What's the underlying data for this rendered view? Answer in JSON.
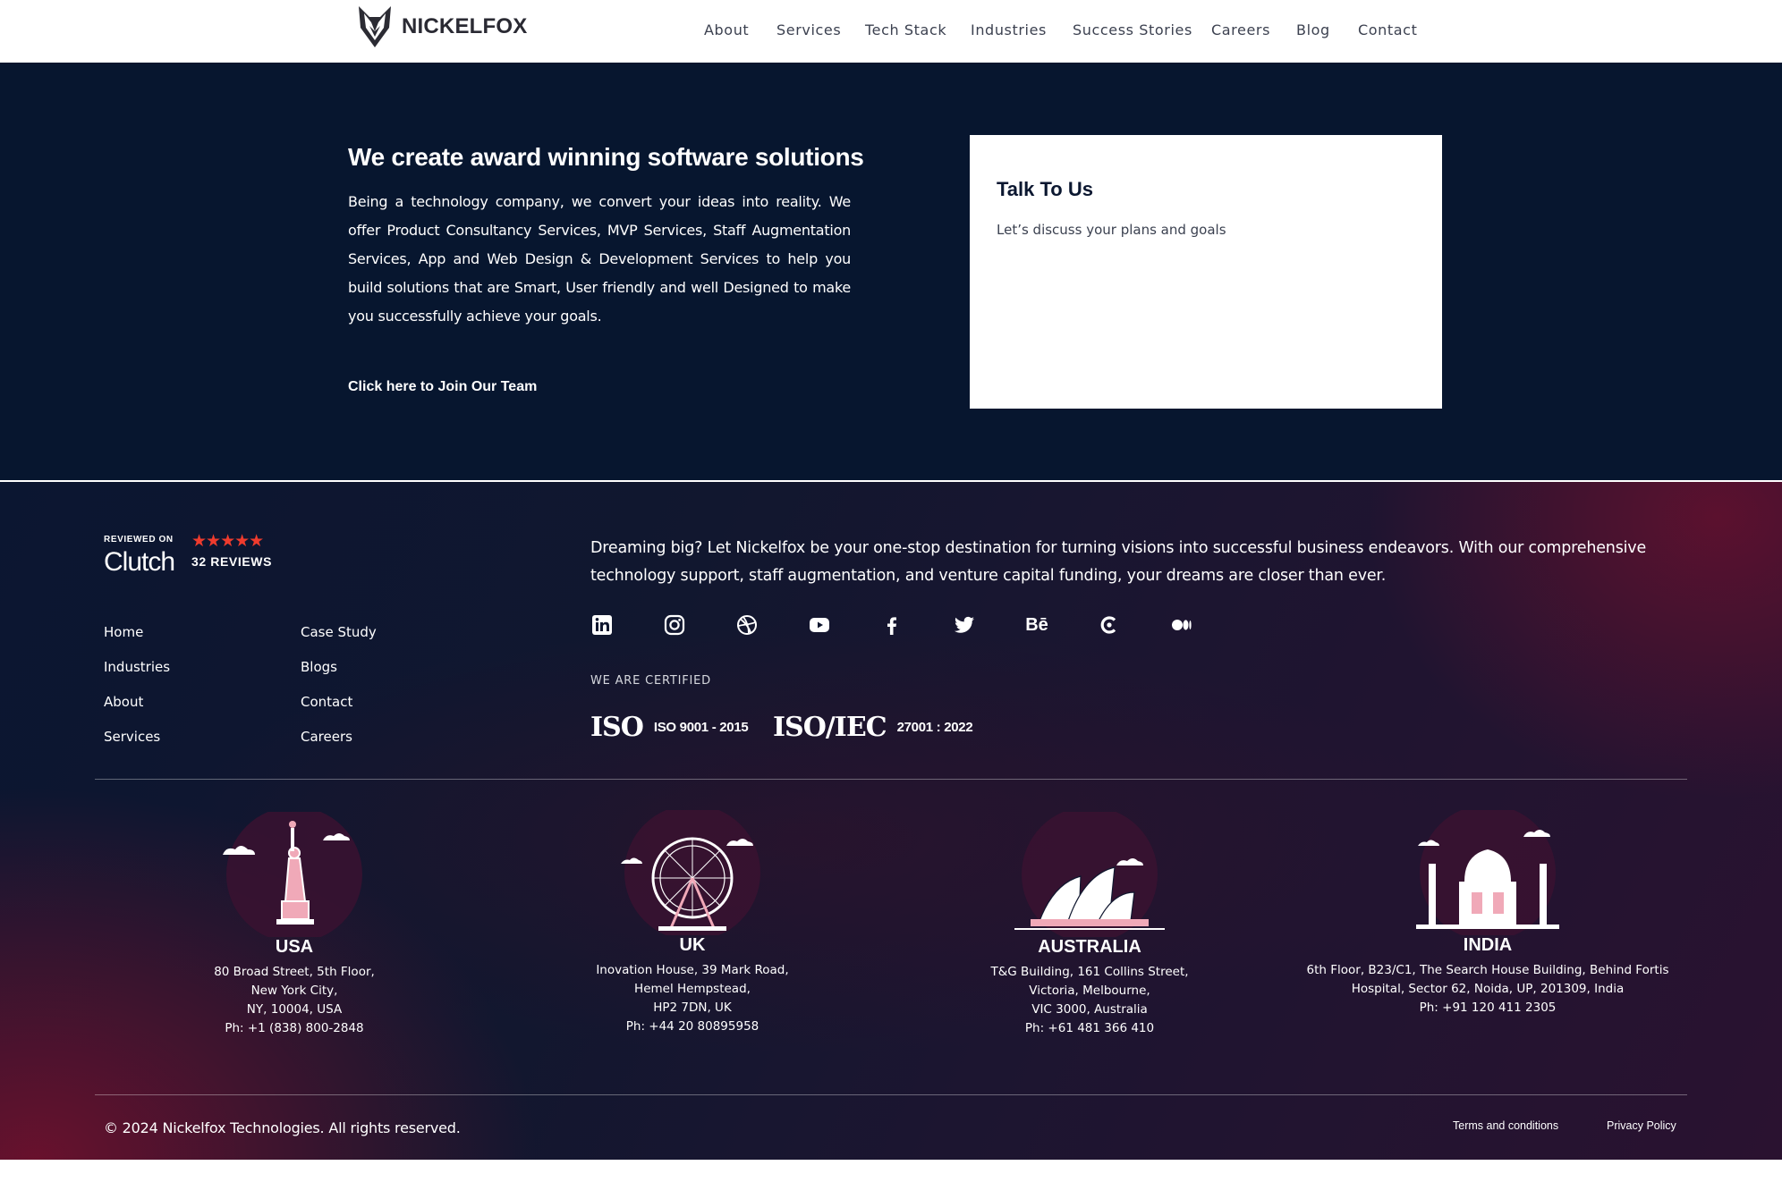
{
  "brand": {
    "name": "NICKELFOX"
  },
  "nav": {
    "items": [
      "About",
      "Services",
      "Tech Stack",
      "Industries",
      "Success Stories",
      "Careers",
      "Blog",
      "Contact"
    ]
  },
  "hero": {
    "title": "We create award winning software solutions",
    "body": "Being a technology company, we convert your ideas into reality. We offer Product Consultancy Services, MVP Services, Staff Augmentation Services, App and Web Design & Development Services to help you build solutions that are Smart, User friendly and well Designed to make you successfully achieve your goals.",
    "join_link": "Click here to Join Our Team"
  },
  "talk": {
    "title": "Talk To Us",
    "subtitle": "Let’s discuss your plans and goals"
  },
  "clutch": {
    "reviewed_on": "REVIEWED ON",
    "name": "Clutch",
    "stars": "★★★★★",
    "count": "32 REVIEWS",
    "rating_stars": 5
  },
  "footer_links": [
    "Home",
    "Case Study",
    "Industries",
    "Blogs",
    "About",
    "Contact",
    "Services",
    "Careers"
  ],
  "tagline": "Dreaming big? Let Nickelfox be your one-stop destination for turning visions into successful business endeavors. With our comprehensive technology support, staff augmentation, and venture capital funding, your dreams are closer than ever.",
  "socials": [
    "linkedin-icon",
    "instagram-icon",
    "dribbble-icon",
    "youtube-icon",
    "facebook-icon",
    "twitter-icon",
    "behance-icon",
    "clutch-icon",
    "medium-icon"
  ],
  "behance_glyph": "Bē",
  "certifications": {
    "label": "WE ARE CERTIFIED",
    "items": [
      {
        "logo": "ISO",
        "code": "ISO 9001 - 2015"
      },
      {
        "logo": "ISO/IEC",
        "code": "27001 : 2022"
      }
    ]
  },
  "offices": [
    {
      "name": "USA",
      "address": "80 Broad Street, 5th Floor,\nNew York City,\nNY, 10004, USA\nPh: +1 (838) 800-2848"
    },
    {
      "name": "UK",
      "address": "Inovation House, 39 Mark Road,\nHemel Hempstead,\nHP2 7DN, UK\nPh: +44 20 80895958"
    },
    {
      "name": "AUSTRALIA",
      "address": "T&G Building, 161 Collins Street,\nVictoria, Melbourne,\nVIC 3000, Australia\nPh: +61 481 366 410"
    },
    {
      "name": "INDIA",
      "address": "6th Floor, B23/C1, The Search House Building, Behind Fortis\nHospital, Sector 62, Noida, UP, 201309, India\nPh: +91 120 411 2305"
    }
  ],
  "copyright": "© 2024 Nickelfox Technologies. All rights reserved.",
  "legal": {
    "terms": "Terms and conditions",
    "privacy": "Privacy Policy"
  },
  "colors": {
    "hero_bg": "#07162f",
    "footer_accent": "#78102c",
    "star": "#ef3b2d",
    "landmark_pink": "#f0a9b8"
  }
}
